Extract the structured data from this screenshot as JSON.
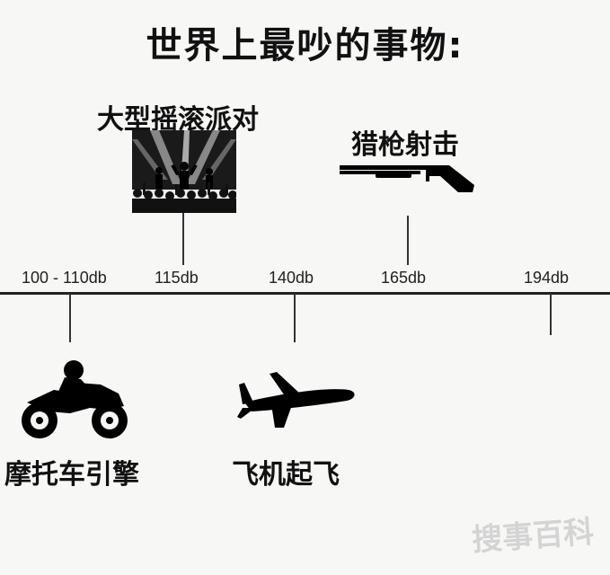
{
  "title": "世界上最吵的事物:",
  "timeline": {
    "ticks": [
      {
        "label": "100 - 110db"
      },
      {
        "label": "115db"
      },
      {
        "label": "140db"
      },
      {
        "label": "165db"
      },
      {
        "label": "194db"
      }
    ]
  },
  "events": {
    "rock_party": {
      "label": "大型摇滚派对",
      "db": "115db"
    },
    "gunshot": {
      "label": "猎枪射击",
      "db": "165db"
    },
    "motorcycle": {
      "label": "摩托车引擎",
      "db": "100 - 110db"
    },
    "airplane": {
      "label": "飞机起飞",
      "db": "140db"
    }
  },
  "watermark": "搜事百科"
}
